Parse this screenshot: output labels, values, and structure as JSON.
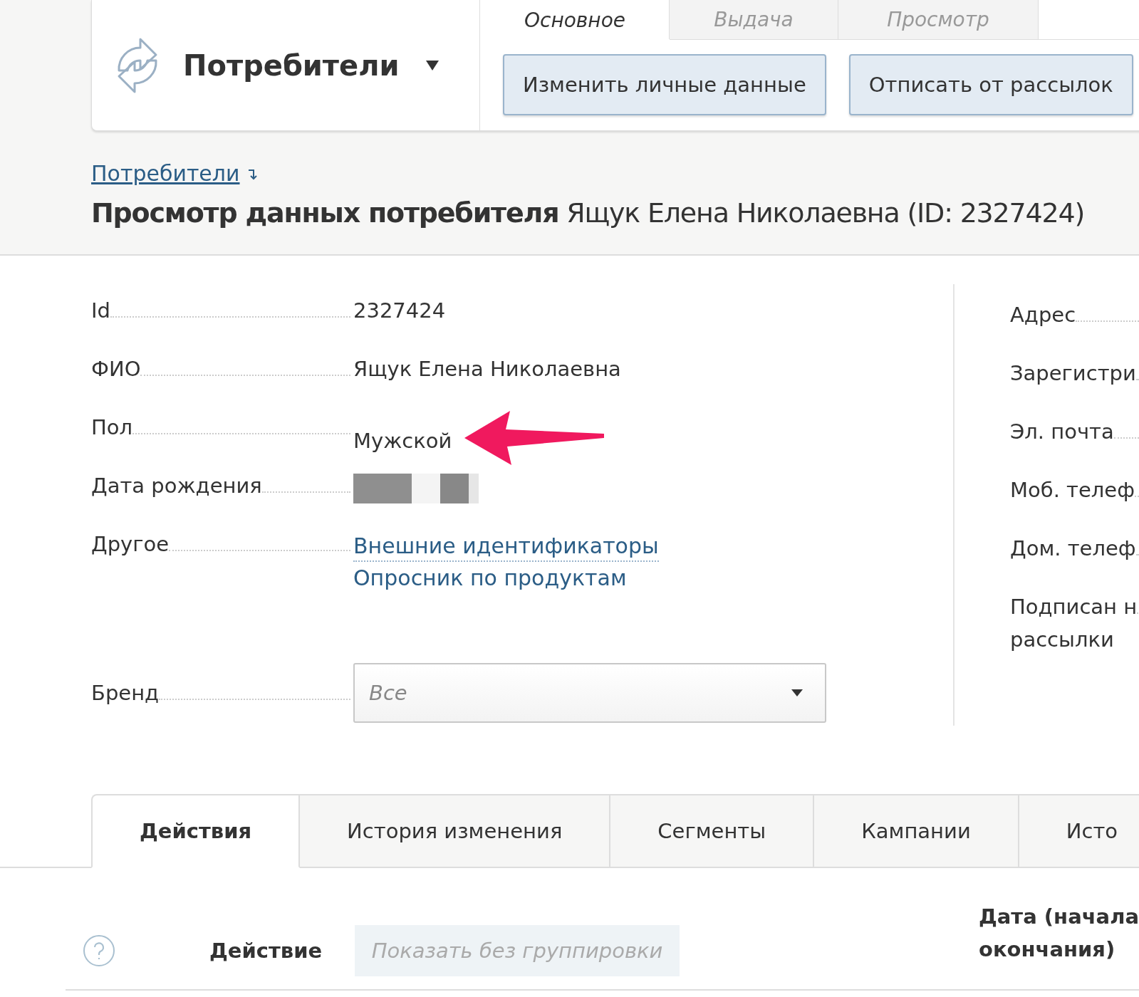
{
  "app_menu": {
    "title": "Потребители"
  },
  "top_tabs": [
    {
      "label": "Основное",
      "selected": true
    },
    {
      "label": "Выдача",
      "selected": false
    },
    {
      "label": "Просмотр",
      "selected": false
    }
  ],
  "action_buttons": [
    "Изменить личные данные",
    "Отписать от рассылок"
  ],
  "breadcrumb": {
    "link": "Потребители"
  },
  "page_title": "**Просмотр данных потребителя** Ящук Елена Николаевна (ID: 2327424)",
  "fields": [
    {
      "label": "Id",
      "kind": "text",
      "value": "2327424"
    },
    {
      "label": "ФИО",
      "kind": "text",
      "value": "Ящук Елена Николаевна"
    },
    {
      "label": "Пол",
      "kind": "text",
      "value": "Мужской",
      "annotated": true
    },
    {
      "label": "Дата рождения",
      "kind": "redacted"
    },
    {
      "label": "Другое",
      "kind": "links",
      "links": [
        "Внешние идентификаторы",
        "Опросник по продуктам"
      ]
    },
    {
      "label": "Бренд",
      "kind": "select",
      "value": "Все"
    }
  ],
  "right_fields": [
    [
      "Адрес"
    ],
    [
      "Зарегистри"
    ],
    [
      "Эл. почта"
    ],
    [
      "Моб. телеф"
    ],
    [
      "Дом. телеф"
    ],
    [
      "Подписан н",
      "рассылки"
    ]
  ],
  "bottom_tabs": [
    {
      "label": "Действия",
      "selected": true
    },
    {
      "label": "История изменения",
      "selected": false
    },
    {
      "label": "Сегменты",
      "selected": false
    },
    {
      "label": "Кампании",
      "selected": false
    },
    {
      "label": "Исто",
      "selected": false
    }
  ],
  "table_header": {
    "action_column": "Действие",
    "grouping": "Показать без группировки",
    "date_column": [
      "Дата (начала",
      "окончания)"
    ]
  }
}
